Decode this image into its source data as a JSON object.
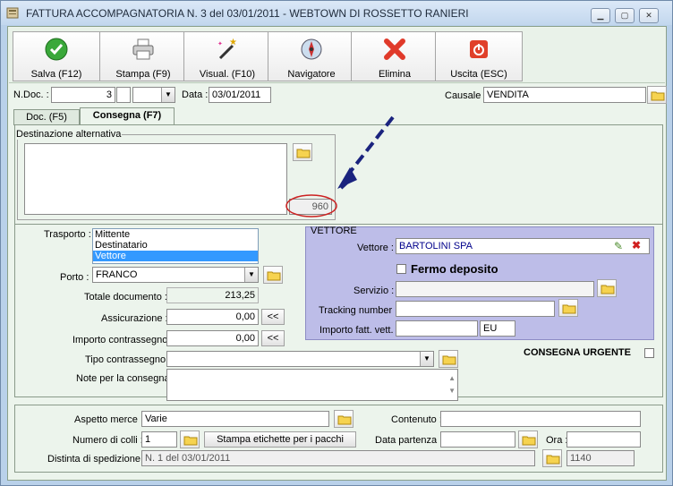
{
  "window": {
    "title": "FATTURA ACCOMPAGNATORIA N. 3  del 03/01/2011 - WEBTOWN DI ROSSETTO RANIERI",
    "controls": [
      "minimize",
      "maximize",
      "close"
    ]
  },
  "toolbar": {
    "buttons": [
      {
        "label": "Salva (F12)",
        "icon": "check-icon"
      },
      {
        "label": "Stampa (F9)",
        "icon": "printer-icon"
      },
      {
        "label": "Visual. (F10)",
        "icon": "magic-wand-icon"
      },
      {
        "label": "Navigatore",
        "icon": "compass-icon"
      },
      {
        "label": "Elimina",
        "icon": "delete-x-icon"
      },
      {
        "label": "Uscita (ESC)",
        "icon": "power-icon"
      }
    ]
  },
  "header": {
    "ndoc_label": "N.Doc. :",
    "ndoc_value": "3",
    "data_label": "Data :",
    "data_value": "03/01/2011",
    "causale_label": "Causale :",
    "causale_value": "VENDITA"
  },
  "tabs": [
    {
      "label": "Doc. (F5)",
      "active": false
    },
    {
      "label": "Consegna (F7)",
      "active": true
    }
  ],
  "destinazione": {
    "legend": "Destinazione alternativa",
    "code": "960"
  },
  "shipping": {
    "trasporto_label": "Trasporto :",
    "trasporto_options": [
      "Mittente",
      "Destinatario",
      "Vettore"
    ],
    "trasporto_selected": "Vettore",
    "porto_label": "Porto :",
    "porto_value": "FRANCO",
    "totale_label": "Totale documento :",
    "totale_value": "213,25",
    "assicurazione_label": "Assicurazione :",
    "assicurazione_value": "0,00",
    "contrassegno_label": "Importo contrassegno :",
    "contrassegno_value": "0,00",
    "copy_button": "<<",
    "tipo_contrassegno_label": "Tipo contrassegno :",
    "tipo_contrassegno_value": "",
    "note_label": "Note per la consegna"
  },
  "vettore": {
    "legend": "VETTORE",
    "vettore_label": "Vettore :",
    "vettore_value": "BARTOLINI SPA",
    "fermo_label": "Fermo deposito",
    "servizio_label": "Servizio :",
    "tracking_label": "Tracking number :",
    "importo_label": "Importo fatt. vett. :",
    "importo_currency": "EU"
  },
  "urgent": {
    "label": "CONSEGNA URGENTE"
  },
  "goods": {
    "aspetto_label": "Aspetto merce :",
    "aspetto_value": "Varie",
    "contenuto_label": "Contenuto :",
    "colli_label": "Numero di colli :",
    "colli_value": "1",
    "labels_button": "Stampa etichette per i pacchi",
    "data_partenza_label": "Data partenza :",
    "ora_label": "Ora :",
    "distinta_label": "Distinta di spedizione :",
    "distinta_value": "N. 1 del 03/01/2011",
    "distinta_code": "1140"
  },
  "colors": {
    "window_frame": "#b9d1ea",
    "client_bg": "#ecf4ec",
    "vettore_bg": "#bdbde8",
    "annotation_arrow": "#1a237e",
    "annotation_circle": "#cc2222"
  }
}
